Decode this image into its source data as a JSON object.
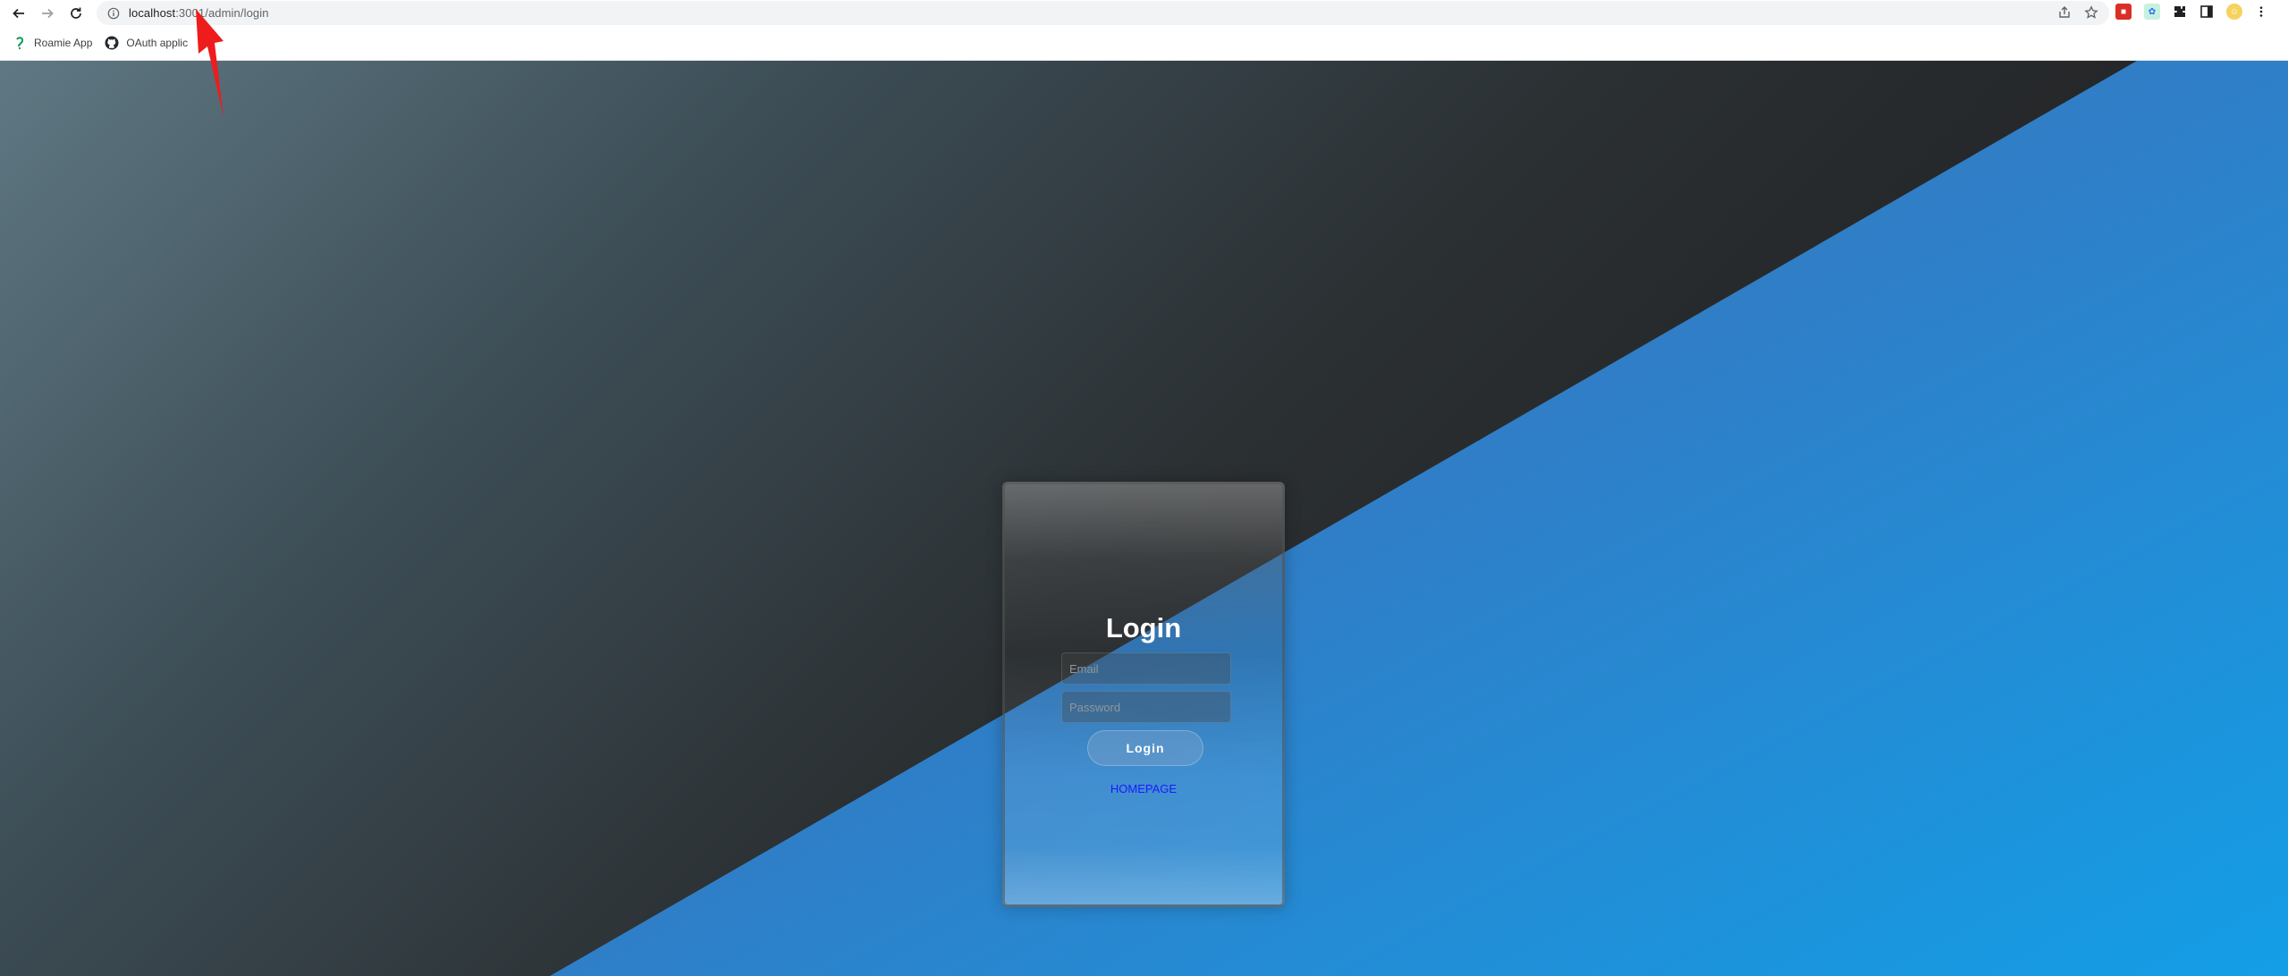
{
  "browser": {
    "url_host": "localhost",
    "url_rest": ":3001/admin/login",
    "bookmarks": [
      {
        "label": "Roamie App",
        "icon": "roamie-icon"
      },
      {
        "label": "OAuth applic",
        "icon": "github-icon"
      }
    ],
    "colors": {
      "omnibox": "#f1f3f4",
      "accent": "#1a73e8"
    }
  },
  "login": {
    "title": "Login",
    "email_placeholder": "Email",
    "password_placeholder": "Password",
    "button_label": "Login",
    "homepage_link": "HOMEPAGE"
  },
  "theme": {
    "dark_bg": "#2b3033",
    "blue_bg": "#2f7fc8",
    "link_color": "#1a1aff"
  }
}
